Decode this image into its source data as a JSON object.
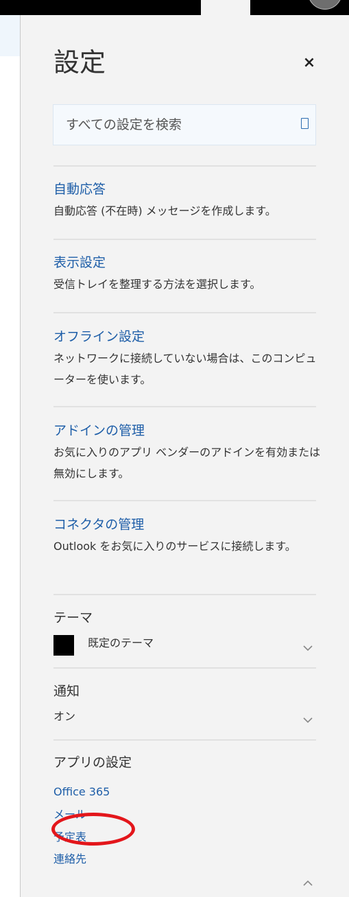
{
  "panel": {
    "title": "設定",
    "close_glyph": "×"
  },
  "search": {
    "placeholder": "すべての設定を検索",
    "icon": "search-icon"
  },
  "sections": [
    {
      "link": "自動応答",
      "description": "自動応答 (不在時) メッセージを作成します。"
    },
    {
      "link": "表示設定",
      "description": "受信トレイを整理する方法を選択します。"
    },
    {
      "link": "オフライン設定",
      "description": "ネットワークに接続していない場合は、このコンピューターを使います。"
    },
    {
      "link": "アドインの管理",
      "description": "お気に入りのアプリ ベンダーのアドインを有効または無効にします。"
    },
    {
      "link": "コネクタの管理",
      "description": "Outlook をお気に入りのサービスに接続します。"
    }
  ],
  "theme": {
    "title": "テーマ",
    "value": "既定のテーマ",
    "swatch_color": "#000000",
    "chevron": "chevron-down-icon"
  },
  "notifications": {
    "title": "通知",
    "value": "オン",
    "chevron": "chevron-down-icon"
  },
  "app_settings": {
    "title": "アプリの設定",
    "links": [
      "Office 365",
      "メール",
      "予定表",
      "連絡先"
    ],
    "highlighted": "メール",
    "highlight_color": "#e3161b",
    "chevron": "chevron-up-icon"
  },
  "colors": {
    "link": "#1e5ea8",
    "panel_bg": "#f3f3f3",
    "text": "#333333"
  }
}
